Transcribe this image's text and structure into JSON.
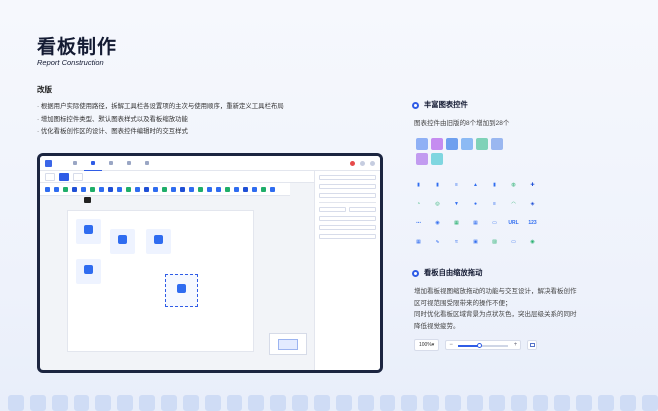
{
  "header": {
    "title": "看板制作",
    "subtitle": "Report Construction",
    "section": "改版",
    "bullets": [
      "· 根据用户实际使用路径，拆解工具栏各设置项的主次与使用顺序，重新定义工具栏布局",
      "· 增加图标控件类型、默认图表样式以及看板缩放功能",
      "· 优化看板创作区的设计、图表控件编辑时的交互样式"
    ]
  },
  "features": {
    "charts": {
      "title": "丰富图表控件",
      "desc": "图表控件由旧版的8个增加到28个"
    },
    "zoom": {
      "title": "看板自由缩放拖动",
      "desc": [
        "增加看板视图缩放拖动的功能与交互设计，解决看板创作",
        "区可视范围受限带来的操作不便；",
        "同时优化看板区域背景为点状灰色，突出层级关系的同时",
        "降低视觉疲劳。"
      ],
      "zoom_value": "100%▾",
      "zoom_level": 0.4
    }
  },
  "colors": {
    "accent": "#2f5ce6",
    "title": "#141b33"
  },
  "icons": {
    "old": [
      "#8fb0f5",
      "#c58cf0",
      "#6fa0ef",
      "#8cbaf4",
      "#7fd2b8",
      "#9ab7f0",
      "#c29bf0",
      "#7fd6e0"
    ],
    "new": [
      {
        "name": "bar-chart-icon",
        "color": "#2f6cf0",
        "glyph": "▮"
      },
      {
        "name": "column-chart-icon",
        "color": "#2f6cf0",
        "glyph": "▮"
      },
      {
        "name": "list-chart-icon",
        "color": "#2f6cf0",
        "glyph": "≡"
      },
      {
        "name": "area-chart-icon",
        "color": "#2f6cf0",
        "glyph": "▲"
      },
      {
        "name": "column-group-icon",
        "color": "#2f6cf0",
        "glyph": "▮"
      },
      {
        "name": "donut-chart-icon",
        "color": "#1fae6a",
        "glyph": "◍"
      },
      {
        "name": "scatter-icon",
        "color": "#1f4fd6",
        "glyph": "✚"
      },
      {
        "name": "pie-chart-icon",
        "color": "#1fae6a",
        "glyph": "◔"
      },
      {
        "name": "ring-chart-icon",
        "color": "#1fae6a",
        "glyph": "◎"
      },
      {
        "name": "funnel-icon",
        "color": "#2f6cf0",
        "glyph": "▼"
      },
      {
        "name": "bubble-icon",
        "color": "#2f6cf0",
        "glyph": "●"
      },
      {
        "name": "stacked-bar-icon",
        "color": "#2f6cf0",
        "glyph": "≡"
      },
      {
        "name": "gauge-icon",
        "color": "#1fae6a",
        "glyph": "◠"
      },
      {
        "name": "map-icon",
        "color": "#1f4fd6",
        "glyph": "◈"
      },
      {
        "name": "network-icon",
        "color": "#2f6cf0",
        "glyph": "⋯"
      },
      {
        "name": "radar-icon",
        "color": "#2f6cf0",
        "glyph": "◉"
      },
      {
        "name": "heat-icon",
        "color": "#1fae6a",
        "glyph": "▦"
      },
      {
        "name": "table-icon",
        "color": "#2f6cf0",
        "glyph": "▦"
      },
      {
        "name": "card-icon",
        "color": "#2f6cf0",
        "glyph": "▭"
      },
      {
        "name": "url-icon",
        "color": "#2f6cf0",
        "glyph": "URL"
      },
      {
        "name": "number-icon",
        "color": "#2f6cf0",
        "glyph": "123"
      },
      {
        "name": "grid-table-icon",
        "color": "#2f6cf0",
        "glyph": "▦"
      },
      {
        "name": "line-chart-icon",
        "color": "#2f6cf0",
        "glyph": "∿"
      },
      {
        "name": "wave-icon",
        "color": "#2f6cf0",
        "glyph": "≈"
      },
      {
        "name": "kpi-icon",
        "color": "#2f6cf0",
        "glyph": "▣"
      },
      {
        "name": "image-icon",
        "color": "#1fae6a",
        "glyph": "▨"
      },
      {
        "name": "text-icon",
        "color": "#2f6cf0",
        "glyph": "▭"
      },
      {
        "name": "progress-ring-icon",
        "color": "#1fae6a",
        "glyph": "◉"
      }
    ]
  }
}
